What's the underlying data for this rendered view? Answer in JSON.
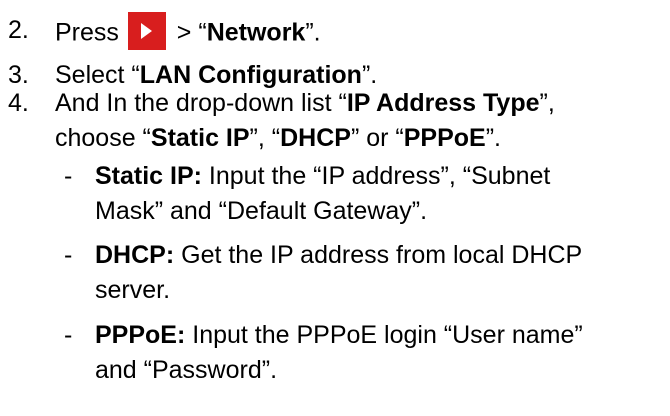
{
  "steps": [
    {
      "number": "2.",
      "pre": "Press",
      "icon": "play-icon",
      "post_a": " > “",
      "post_bold": "Network",
      "post_b": "”."
    },
    {
      "number": "3.",
      "pre": "Select “",
      "bold": "LAN Configuration",
      "post": "”."
    },
    {
      "number": "4.",
      "pre": "And In the drop-down list “",
      "bold": "IP Address Type",
      "post": "”,",
      "cont_pre": "choose “",
      "cont_b1": "Static IP",
      "cont_m1": "”, “",
      "cont_b2": "DHCP",
      "cont_m2": "” or “",
      "cont_b3": "PPPoE",
      "cont_post": "”."
    }
  ],
  "options": [
    {
      "dash": "-",
      "label": "Static IP:",
      "text": " Input the “IP address”, “Subnet",
      "cont": "Mask” and “Default Gateway”."
    },
    {
      "dash": "-",
      "label": "DHCP:",
      "text": " Get the IP address from local DHCP",
      "cont": "server."
    },
    {
      "dash": "-",
      "label": "PPPoE:",
      "text": " Input the PPPoE login “User name”",
      "cont": "and “Password”."
    }
  ]
}
